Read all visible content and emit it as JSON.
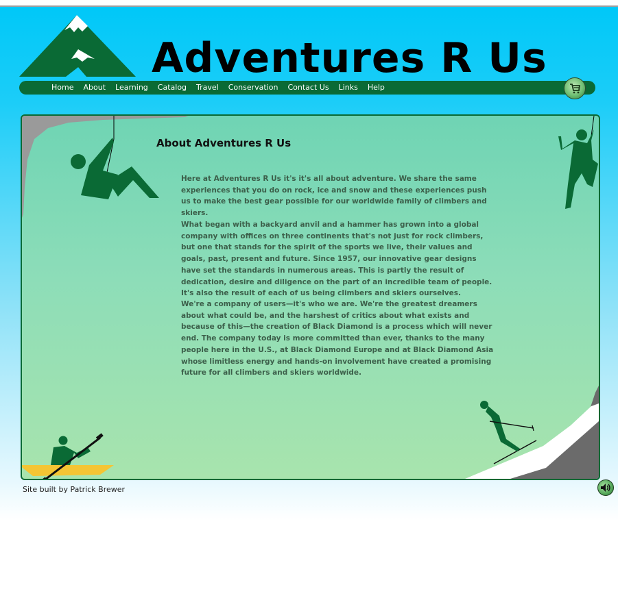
{
  "header": {
    "site_title": "Adventures R Us"
  },
  "nav": {
    "items": [
      "Home",
      "About",
      "Learning",
      "Catalog",
      "Travel",
      "Conservation",
      "Contact Us",
      "Links",
      "Help"
    ]
  },
  "icons": {
    "cart": "shopping-cart-icon",
    "sound": "speaker-icon"
  },
  "main": {
    "heading": "About Adventures R Us",
    "paragraphs": [
      "Here at Adventures R Us it's it's all about adventure. We share the same experiences that you do on rock, ice and snow and these experiences push us to make the best gear possible for our worldwide family of climbers and skiers.",
      "What began with a backyard anvil and a hammer has grown into a global company with offices on three continents that's not just for rock climbers, but one that stands for the spirit of the sports we live, their values and goals, past, present and future. Since 1957, our innovative gear designs have set the standards in numerous areas. This is partly the result of dedication, desire and diligence on the part of an incredible team of people. It's also the result of each of us being climbers and skiers ourselves.",
      "We're a company of users—it's who we are. We're the greatest dreamers about what could be, and the harshest of critics about what exists and because of this—the creation of Black Diamond is a process which will never end. The company today is more committed than ever, thanks to the many people here in the U.S., at Black Diamond Europe and at Black Diamond Asia whose limitless energy and hands-on involvement have created a promising future for all climbers and skiers worldwide."
    ]
  },
  "footer": {
    "credit": "Site built by Patrick Brewer"
  },
  "colors": {
    "brand_green": "#0a6a35",
    "sky": "#00c8f8",
    "panel": "#8dddb8",
    "text": "#3c5f4a"
  }
}
